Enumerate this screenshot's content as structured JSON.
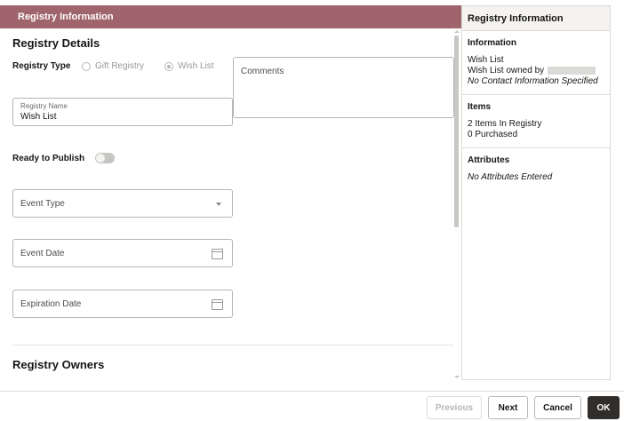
{
  "header": {
    "title": "Registry Information"
  },
  "details": {
    "title": "Registry Details",
    "registry_type_label": "Registry Type",
    "options": [
      "Gift Registry",
      "Wish List"
    ],
    "selected_option": "Wish List",
    "comments_label": "Comments",
    "registry_name_label": "Registry Name",
    "registry_name_value": "Wish List",
    "ready_to_publish_label": "Ready to Publish",
    "ready_to_publish": false,
    "event_type_label": "Event Type",
    "event_date_label": "Event Date",
    "expiration_date_label": "Expiration Date"
  },
  "owners": {
    "title": "Registry Owners"
  },
  "side_panel": {
    "title": "Registry Information",
    "information": {
      "title": "Information",
      "line1": "Wish List",
      "line2": "Wish List owned by",
      "line3": "No Contact Information Specified"
    },
    "items": {
      "title": "Items",
      "line1": "2 Items In Registry",
      "line2": "0 Purchased"
    },
    "attributes": {
      "title": "Attributes",
      "line1": "No Attributes Entered"
    }
  },
  "footer": {
    "previous": "Previous",
    "next": "Next",
    "cancel": "Cancel",
    "ok": "OK"
  },
  "colors": {
    "header_bg": "#a0646c",
    "primary_button": "#312d2a"
  },
  "icons": [
    "chevron-down-icon",
    "calendar-icon"
  ]
}
